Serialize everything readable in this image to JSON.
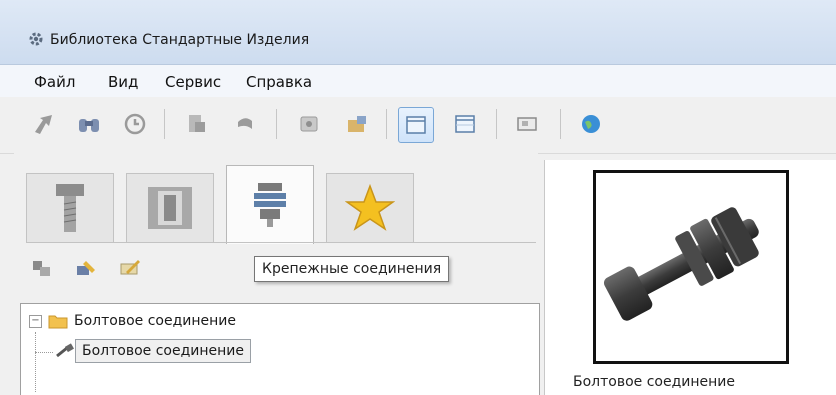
{
  "window": {
    "title": "Библиотека Стандартные Изделия"
  },
  "menu": [
    {
      "label": "Файл"
    },
    {
      "label": "Вид"
    },
    {
      "label": "Сервис"
    },
    {
      "label": "Справка"
    }
  ],
  "toolbar": {
    "buttons": [
      {
        "icon": "export-arrow-icon"
      },
      {
        "icon": "binoculars-icon"
      },
      {
        "icon": "history-clock-icon"
      },
      {
        "icon": "properties-icon"
      },
      {
        "icon": "undo-icon"
      },
      {
        "icon": "catalog-icon"
      },
      {
        "icon": "lock-folder-icon"
      },
      {
        "icon": "list-view-icon",
        "active": true
      },
      {
        "icon": "table-view-icon"
      },
      {
        "icon": "preview-view-icon"
      },
      {
        "icon": "globe-icon"
      }
    ]
  },
  "tabs": [
    {
      "icon": "bolt-icon"
    },
    {
      "icon": "bushing-icon"
    },
    {
      "icon": "fastener-joint-icon",
      "active": true
    },
    {
      "icon": "favorites-star-icon"
    }
  ],
  "tooltip": {
    "text": "Крепежные соединения"
  },
  "tree": {
    "items": [
      {
        "label": "Болтовое соединение",
        "type": "folder",
        "expanded": true
      },
      {
        "label": "Болтовое соединение",
        "type": "item",
        "selected": true
      }
    ]
  },
  "preview": {
    "caption": "Болтовое соединение"
  },
  "colors": {
    "accent": "#7aa7d6",
    "folder": "#f2c14e",
    "star": "#f4c020"
  }
}
